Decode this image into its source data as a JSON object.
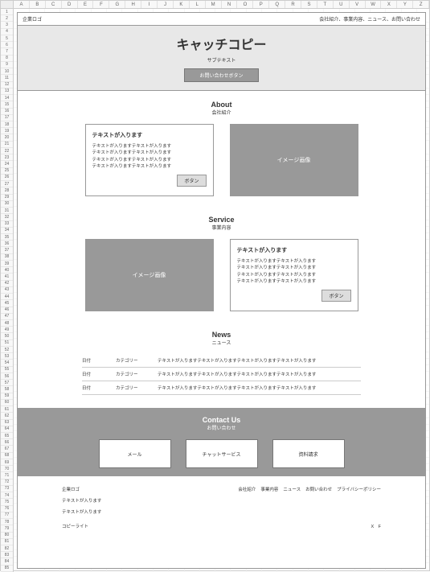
{
  "columns": [
    "A",
    "B",
    "C",
    "D",
    "E",
    "F",
    "G",
    "H",
    "I",
    "J",
    "K",
    "L",
    "M",
    "N",
    "O",
    "P",
    "Q",
    "R",
    "S",
    "T",
    "U",
    "V",
    "W",
    "X",
    "Y",
    "Z"
  ],
  "topbar": {
    "logo": "企業ロゴ",
    "nav": "会社紹介、事業内容、ニュース、お問い合わせ"
  },
  "hero": {
    "title": "キャッチコピー",
    "sub": "サブテキスト",
    "btn": "お問い合わせボタン"
  },
  "about": {
    "heading": "About",
    "jp": "会社紹介",
    "box_title": "テキストが入ります",
    "body": "テキストが入りますテキストが入ります\nテキストが入りますテキストが入ります\nテキストが入りますテキストが入ります\nテキストが入りますテキストが入ります",
    "btn": "ボタン",
    "img": "イメージ画像"
  },
  "service": {
    "heading": "Service",
    "jp": "事業内容",
    "box_title": "テキストが入ります",
    "body": "テキストが入りますテキストが入ります\nテキストが入りますテキストが入ります\nテキストが入りますテキストが入ります\nテキストが入りますテキストが入ります",
    "btn": "ボタン",
    "img": "イメージ画像"
  },
  "news": {
    "heading": "News",
    "jp": "ニュース",
    "rows": [
      {
        "date": "日付",
        "cat": "カテゴリー",
        "text": "テキストが入りますテキストが入りますテキストが入りますテキストが入ります"
      },
      {
        "date": "日付",
        "cat": "カテゴリー",
        "text": "テキストが入りますテキストが入りますテキストが入りますテキストが入ります"
      },
      {
        "date": "日付",
        "cat": "カテゴリー",
        "text": "テキストが入りますテキストが入りますテキストが入りますテキストが入ります"
      }
    ]
  },
  "contact": {
    "heading": "Contact Us",
    "jp": "お問い合わせ",
    "boxes": [
      "メール",
      "チャットサービス",
      "資料請求"
    ]
  },
  "footer": {
    "logo": "企業ロゴ",
    "links": [
      "会社紹介",
      "事業内容",
      "ニュース",
      "お問い合わせ",
      "プライバシーポリシー"
    ],
    "txt1": "テキストが入ります",
    "txt2": "テキストが入ります",
    "copy": "コピーライト",
    "social": "X　F"
  }
}
